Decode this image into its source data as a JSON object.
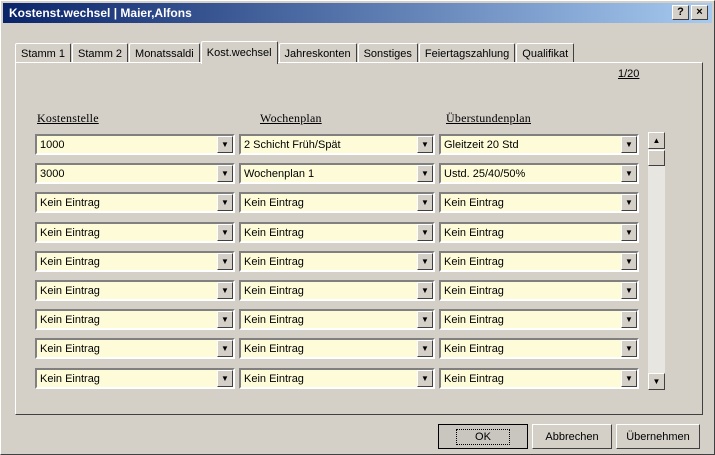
{
  "window": {
    "title": "Kostenst.wechsel | Maier,Alfons",
    "help_label": "?",
    "close_label": "×"
  },
  "tabs": [
    {
      "label": "Stamm 1",
      "active": false
    },
    {
      "label": "Stamm 2",
      "active": false
    },
    {
      "label": "Monatssaldi",
      "active": false
    },
    {
      "label": "Kost.wechsel",
      "active": true
    },
    {
      "label": "Jahreskonten",
      "active": false
    },
    {
      "label": "Sonstiges",
      "active": false
    },
    {
      "label": "Feiertagszahlung",
      "active": false
    },
    {
      "label": "Qualifikat",
      "active": false
    }
  ],
  "page_indicator": "1/20",
  "columns": {
    "kostenstelle": "Kostenstelle",
    "wochenplan": "Wochenplan",
    "ueberstundenplan": "Überstundenplan"
  },
  "rows": [
    {
      "kostenstelle": "1000",
      "wochenplan": "2 Schicht Früh/Spät",
      "ueberstundenplan": "Gleitzeit 20 Std"
    },
    {
      "kostenstelle": "3000",
      "wochenplan": "Wochenplan 1",
      "ueberstundenplan": "Ustd. 25/40/50%"
    },
    {
      "kostenstelle": "Kein Eintrag",
      "wochenplan": "Kein Eintrag",
      "ueberstundenplan": "Kein Eintrag"
    },
    {
      "kostenstelle": "Kein Eintrag",
      "wochenplan": "Kein Eintrag",
      "ueberstundenplan": "Kein Eintrag"
    },
    {
      "kostenstelle": "Kein Eintrag",
      "wochenplan": "Kein Eintrag",
      "ueberstundenplan": "Kein Eintrag"
    },
    {
      "kostenstelle": "Kein Eintrag",
      "wochenplan": "Kein Eintrag",
      "ueberstundenplan": "Kein Eintrag"
    },
    {
      "kostenstelle": "Kein Eintrag",
      "wochenplan": "Kein Eintrag",
      "ueberstundenplan": "Kein Eintrag"
    },
    {
      "kostenstelle": "Kein Eintrag",
      "wochenplan": "Kein Eintrag",
      "ueberstundenplan": "Kein Eintrag"
    },
    {
      "kostenstelle": "Kein Eintrag",
      "wochenplan": "Kein Eintrag",
      "ueberstundenplan": "Kein Eintrag"
    }
  ],
  "icons": {
    "dropdown": "chevron-down-icon",
    "scroll_up": "arrow-up-icon",
    "scroll_down": "arrow-down-icon"
  },
  "buttons": {
    "ok": "OK",
    "cancel": "Abbrechen",
    "apply": "Übernehmen"
  },
  "colors": {
    "titlebar_start": "#0a246a",
    "titlebar_end": "#a6caf0",
    "field_background": "#fefcd8",
    "dialog_background": "#d4d0c8"
  }
}
